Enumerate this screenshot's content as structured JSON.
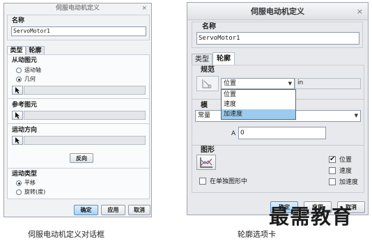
{
  "dialog1": {
    "title": "伺服电动机定义",
    "close": "×",
    "name_label": "名称",
    "name_value": "ServoMotor1",
    "tabs": [
      "类型",
      "轮廓"
    ],
    "driven_entity": {
      "title": "从动图元",
      "options": [
        "运动轴",
        "几何"
      ],
      "selected": 1
    },
    "reference_entity_title": "参考图元",
    "motion_direction_title": "运动方向",
    "reverse_button": "反向",
    "motion_type": {
      "title": "运动类型",
      "options": [
        "平移",
        "旋转(度)"
      ],
      "selected": 0
    },
    "buttons": {
      "ok": "确定",
      "apply": "应用",
      "cancel": "取消"
    }
  },
  "dialog2": {
    "title": "伺服电动机定义",
    "close": "×",
    "name_label": "名称",
    "name_value": "ServoMotor1",
    "tabs": [
      "类型",
      "轮廓"
    ],
    "spec": {
      "title": "规范",
      "selected": "位置",
      "unit": "in",
      "options": [
        "位置",
        "速度",
        "加速度"
      ],
      "highlighted": 2
    },
    "mode": {
      "title": "模",
      "value": "常量"
    },
    "a_label": "A",
    "a_value": "0",
    "graph": {
      "title": "图形",
      "separate_label": "在单独图形中",
      "checks": [
        {
          "label": "位置",
          "checked": true
        },
        {
          "label": "速度",
          "checked": false
        },
        {
          "label": "加速度",
          "checked": false
        }
      ]
    },
    "buttons": {
      "ok": "确定",
      "apply": "应用",
      "cancel": "取消"
    }
  },
  "watermark": "最需教育",
  "captions": [
    "伺服电动机定义对话框",
    "轮廓选项卡"
  ]
}
